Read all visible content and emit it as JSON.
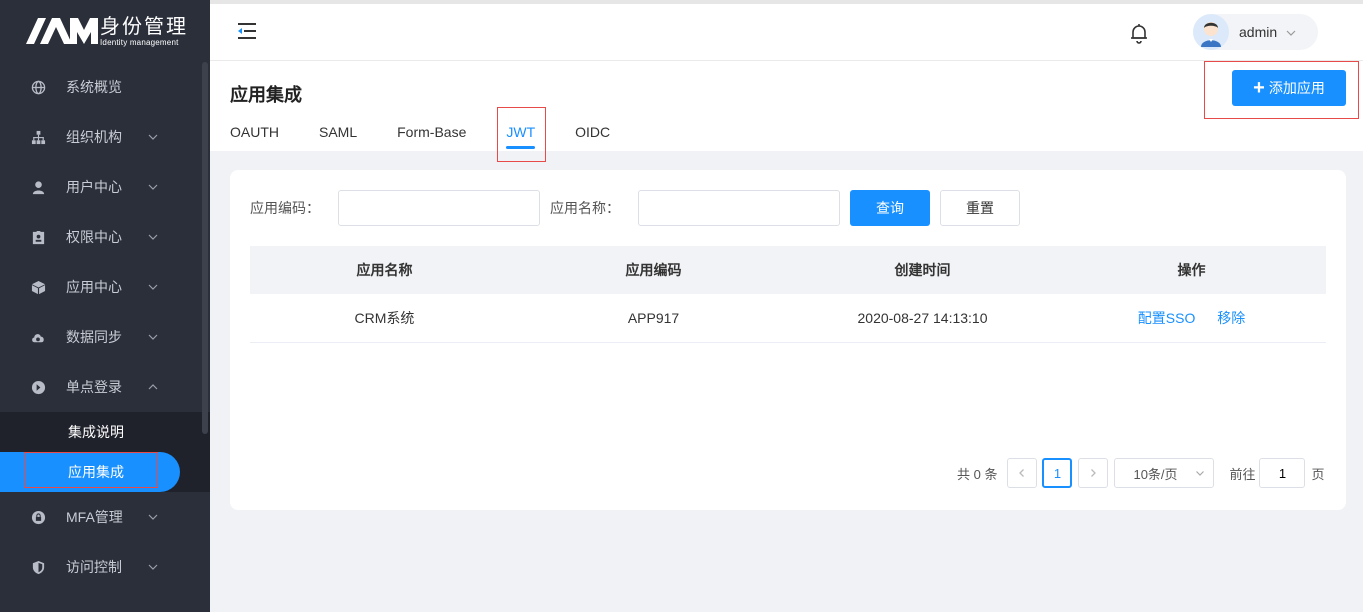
{
  "logo": {
    "mark": "IAM",
    "title_cn": "身份管理",
    "title_en": "Identity management"
  },
  "sidebar": {
    "items": [
      {
        "label": "系统概览",
        "icon": "globe-icon",
        "has_arrow": false
      },
      {
        "label": "组织机构",
        "icon": "org-icon",
        "has_arrow": true
      },
      {
        "label": "用户中心",
        "icon": "user-icon",
        "has_arrow": true
      },
      {
        "label": "权限中心",
        "icon": "badge-icon",
        "has_arrow": true
      },
      {
        "label": "应用中心",
        "icon": "cube-icon",
        "has_arrow": true
      },
      {
        "label": "数据同步",
        "icon": "cloud-sync-icon",
        "has_arrow": true
      },
      {
        "label": "单点登录",
        "icon": "arrow-circle-icon",
        "has_arrow": true,
        "expanded": true
      },
      {
        "label": "MFA管理",
        "icon": "lock-icon",
        "has_arrow": true
      },
      {
        "label": "访问控制",
        "icon": "shield-icon",
        "has_arrow": true
      }
    ],
    "sso_children": [
      {
        "label": "集成说明",
        "active": false
      },
      {
        "label": "应用集成",
        "active": true
      }
    ]
  },
  "header": {
    "user_name": "admin"
  },
  "page": {
    "title": "应用集成",
    "tabs": [
      "OAUTH",
      "SAML",
      "Form-Base",
      "JWT",
      "OIDC"
    ],
    "active_tab": "JWT",
    "add_button": "添加应用"
  },
  "search": {
    "code_label": "应用编码：",
    "code_value": "",
    "name_label": "应用名称：",
    "name_value": "",
    "query_button": "查询",
    "reset_button": "重置"
  },
  "table": {
    "columns": [
      "应用名称",
      "应用编码",
      "创建时间",
      "操作"
    ],
    "rows": [
      {
        "name": "CRM系统",
        "code": "APP917",
        "created": "2020-08-27 14:13:10",
        "actions": [
          "配置SSO",
          "移除"
        ]
      }
    ]
  },
  "pagination": {
    "total_text": "共 0 条",
    "current_page": "1",
    "page_size": "10条/页",
    "goto_label": "前往",
    "goto_value": "1",
    "page_suffix": "页"
  },
  "colors": {
    "primary": "#1890ff",
    "sidebar_bg": "#2b2f3a",
    "highlight_box": "#e84a4a"
  }
}
